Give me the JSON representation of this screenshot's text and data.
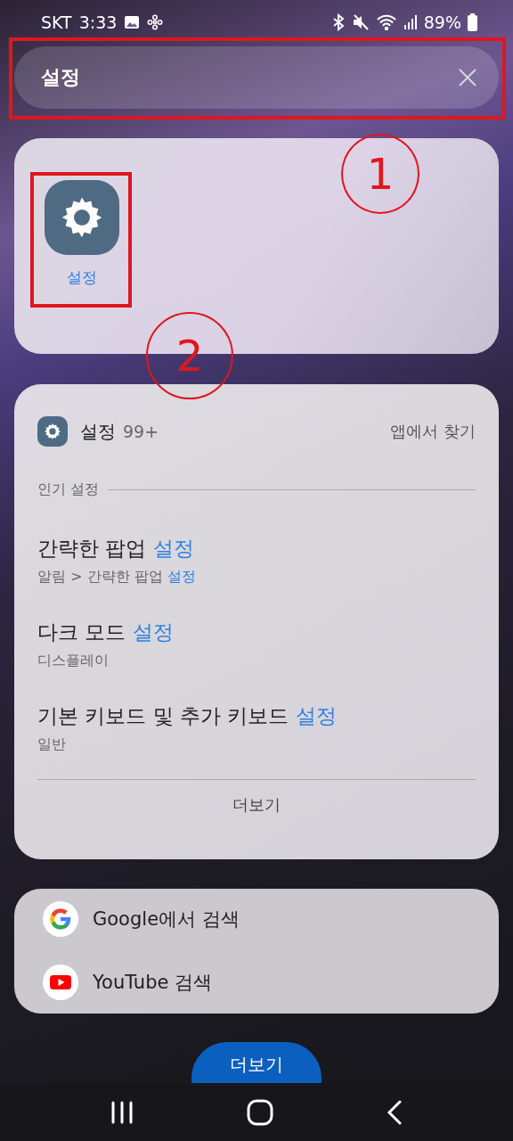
{
  "status_bar": {
    "carrier": "SKT",
    "time": "3:33",
    "battery": "89%"
  },
  "search": {
    "value": "설정"
  },
  "apps": [
    {
      "label": "설정"
    }
  ],
  "settings_results": {
    "title": "설정",
    "count": "99+",
    "action": "앱에서 찾기",
    "section": "인기 설정",
    "more": "더보기",
    "items": [
      {
        "title": "간략한 팝업",
        "match": "설정",
        "path": "알림 > 간략한 팝업",
        "path_match": "설정"
      },
      {
        "title": "다크 모드",
        "match": "설정",
        "path": "디스플레이"
      },
      {
        "title": "기본 키보드 및 추가 키보드",
        "match": "설정",
        "path": "일반"
      }
    ]
  },
  "web_search": [
    {
      "kind": "google",
      "label": "Google에서 검색"
    },
    {
      "kind": "youtube",
      "label": "YouTube 검색"
    }
  ],
  "more_button": "더보기",
  "annotations": [
    {
      "label": "1"
    },
    {
      "label": "2"
    }
  ]
}
